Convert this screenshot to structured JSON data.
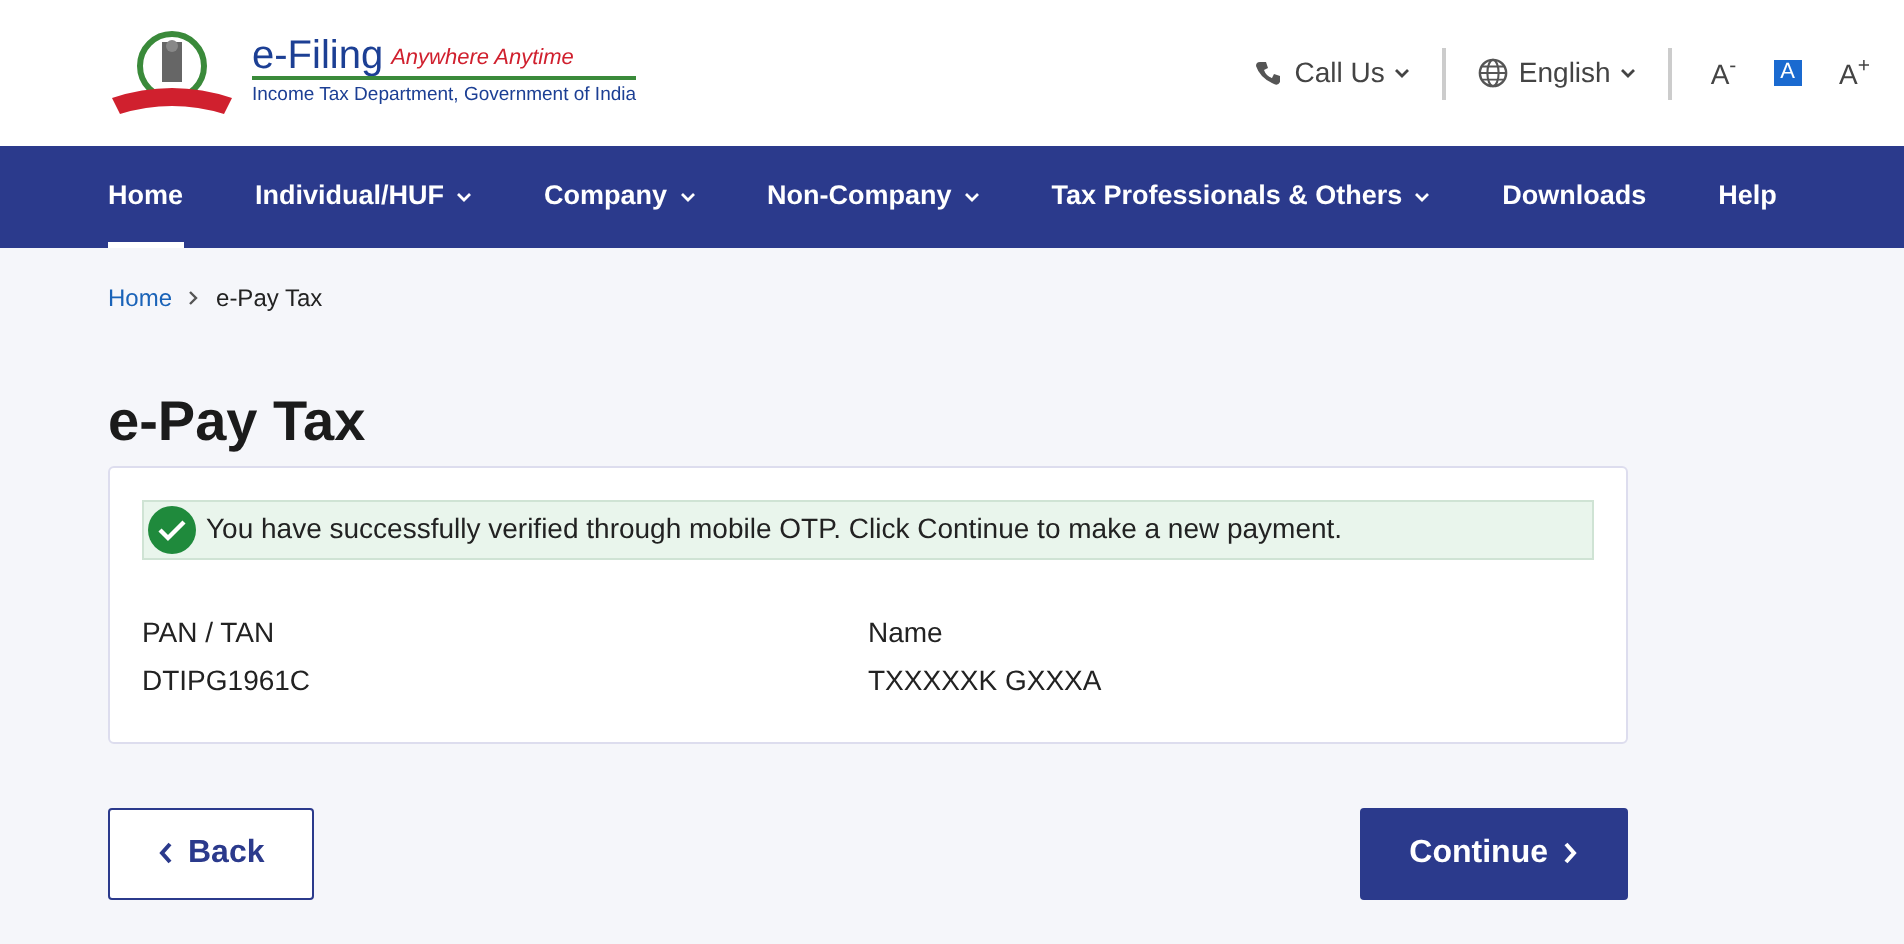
{
  "logo": {
    "title": "e-Filing",
    "tagline": "Anywhere Anytime",
    "subtitle": "Income Tax Department, Government of India"
  },
  "header_links": [
    {
      "label": "Call Us",
      "kind": "phone"
    },
    {
      "label": "English",
      "kind": "globe"
    }
  ],
  "text_size": [
    {
      "label": "A",
      "sign": "-",
      "selected": false
    },
    {
      "label": "A",
      "selected": true
    },
    {
      "label": "A",
      "sign": "+",
      "selected": false
    }
  ],
  "nav": [
    {
      "label": "Home",
      "dropdown": false,
      "selected": true
    },
    {
      "label": "Individual/HUF",
      "dropdown": true,
      "selected": false
    },
    {
      "label": "Company",
      "dropdown": true,
      "selected": false
    },
    {
      "label": "Non-Company",
      "dropdown": true,
      "selected": false
    },
    {
      "label": "Tax Professionals & Others",
      "dropdown": true,
      "selected": false
    },
    {
      "label": "Downloads",
      "dropdown": false,
      "selected": false
    },
    {
      "label": "Help",
      "dropdown": false,
      "selected": false
    }
  ],
  "breadcrumb": [
    {
      "label": "Home",
      "link": true
    },
    {
      "label": "e-Pay Tax",
      "link": false
    }
  ],
  "page_title": "e-Pay Tax",
  "alert": {
    "text": "You have successfully verified through mobile OTP. Click Continue to make a new payment."
  },
  "fields": [
    {
      "label": "PAN / TAN",
      "value": "DTIPG1961C"
    },
    {
      "label": "Name",
      "value": "TXXXXXK GXXXA"
    }
  ],
  "buttons": [
    {
      "label": "Back",
      "kind": "secondary"
    },
    {
      "label": "Continue",
      "kind": "primary"
    }
  ]
}
